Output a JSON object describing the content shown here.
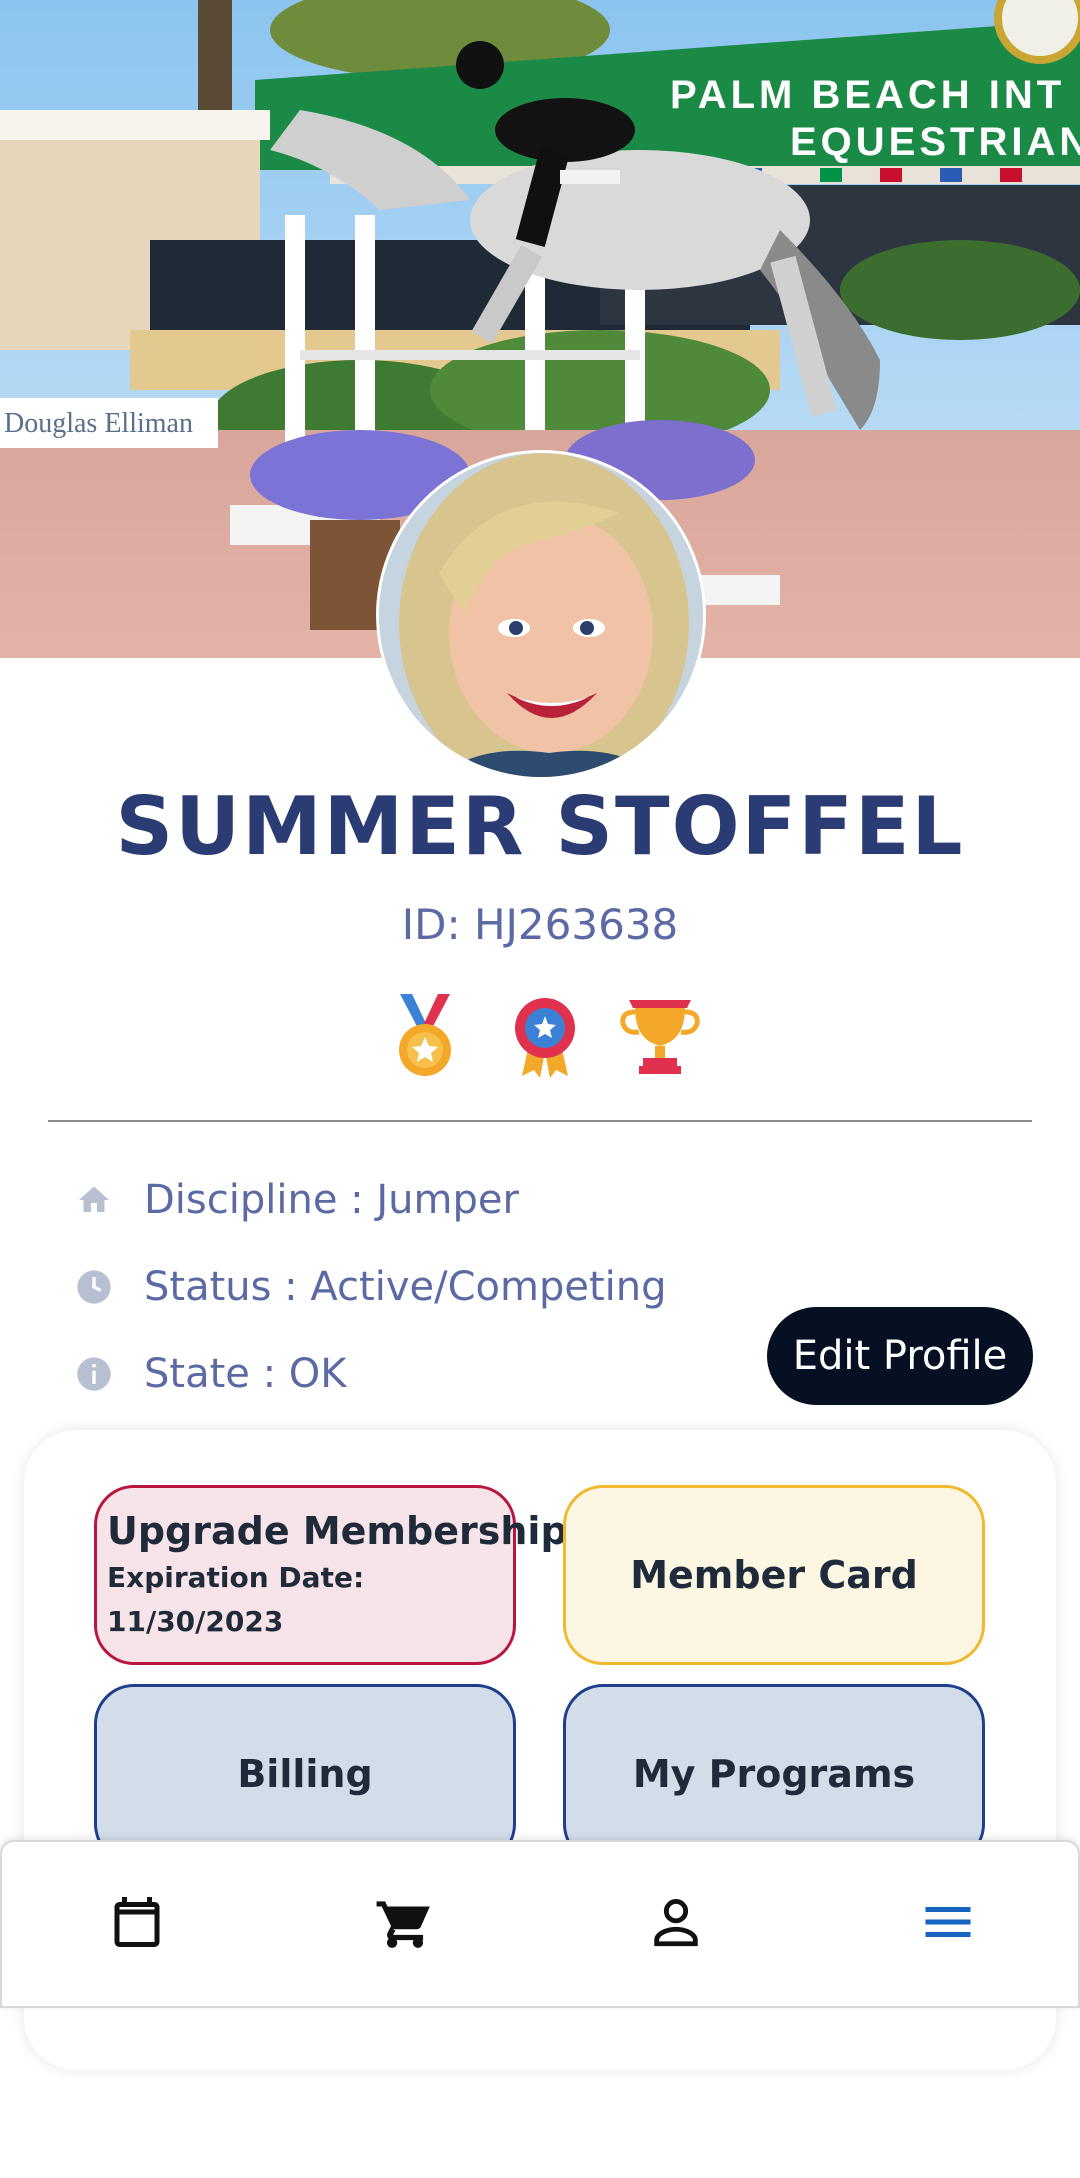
{
  "hero": {
    "banner_text_line1": "PALM BEACH INT",
    "banner_text_line2": "EQUESTRIAN",
    "sponsor_text": "Douglas Elliman"
  },
  "profile": {
    "name": "SUMMER STOFFEL",
    "id_text": "ID: HJ263638"
  },
  "badges": [
    "medal-icon",
    "rosette-icon",
    "trophy-icon"
  ],
  "details": {
    "discipline": "Discipline : Jumper",
    "status": "Status : Active/Competing",
    "state": "State : OK"
  },
  "actions": {
    "edit_profile": "Edit Profile",
    "upgrade_title": "Upgrade Membership",
    "expiration_label": "Expiration Date:",
    "expiration_date": "11/30/2023",
    "member_card": "Member Card",
    "billing": "Billing",
    "my_programs": "My Programs"
  },
  "bottom_nav": {
    "items": [
      "calendar-icon",
      "cart-icon",
      "person-icon",
      "menu-icon"
    ],
    "active": "menu-icon",
    "active_color": "#1565c0"
  },
  "colors": {
    "name": "#2b3b74",
    "secondary_text": "#5b6aa4",
    "edit_button": "#061022",
    "upgrade_border": "#b8163f",
    "member_card_border": "#f0b92f",
    "blue_tile_border": "#1e3f8a"
  }
}
